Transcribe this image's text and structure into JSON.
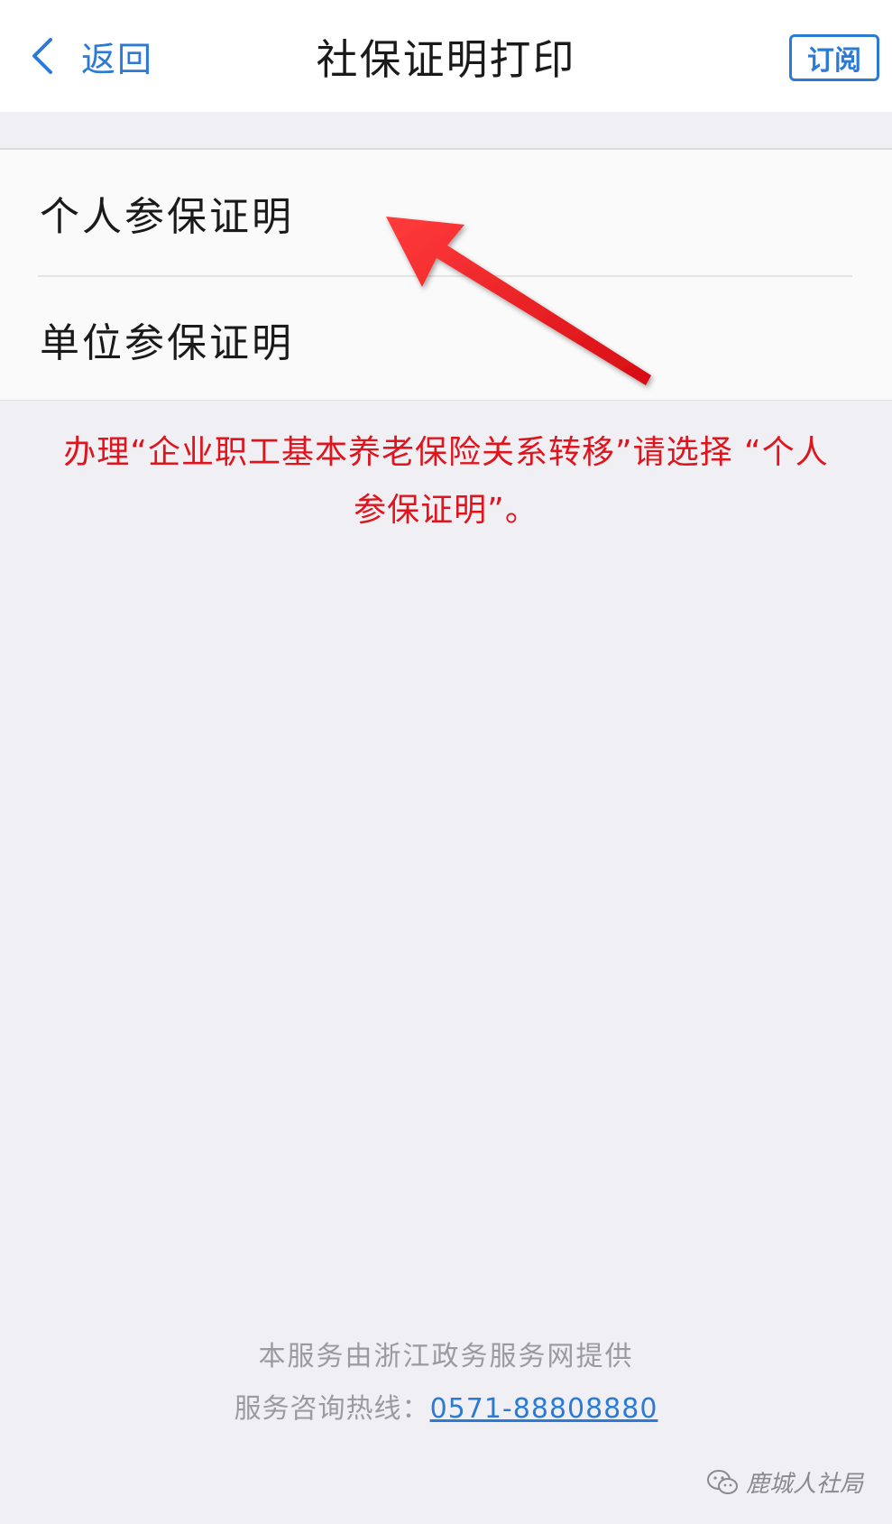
{
  "header": {
    "back_label": "返回",
    "title": "社保证明打印",
    "subscribe_label": "订阅"
  },
  "options": [
    {
      "label": "个人参保证明"
    },
    {
      "label": "单位参保证明"
    }
  ],
  "annotation": {
    "note": "办理“企业职工基本养老保险关系转移”请选择 “个人参保证明”。",
    "color": "#e0141c"
  },
  "footer": {
    "provider": "本服务由浙江政务服务网提供",
    "hotline_label": "服务咨询热线：",
    "hotline_number": "0571-88808880"
  },
  "watermark": {
    "text": "鹿城人社局",
    "icon": "wechat-icon"
  },
  "colors": {
    "accent": "#2a7ad6",
    "background": "#efeff4"
  }
}
